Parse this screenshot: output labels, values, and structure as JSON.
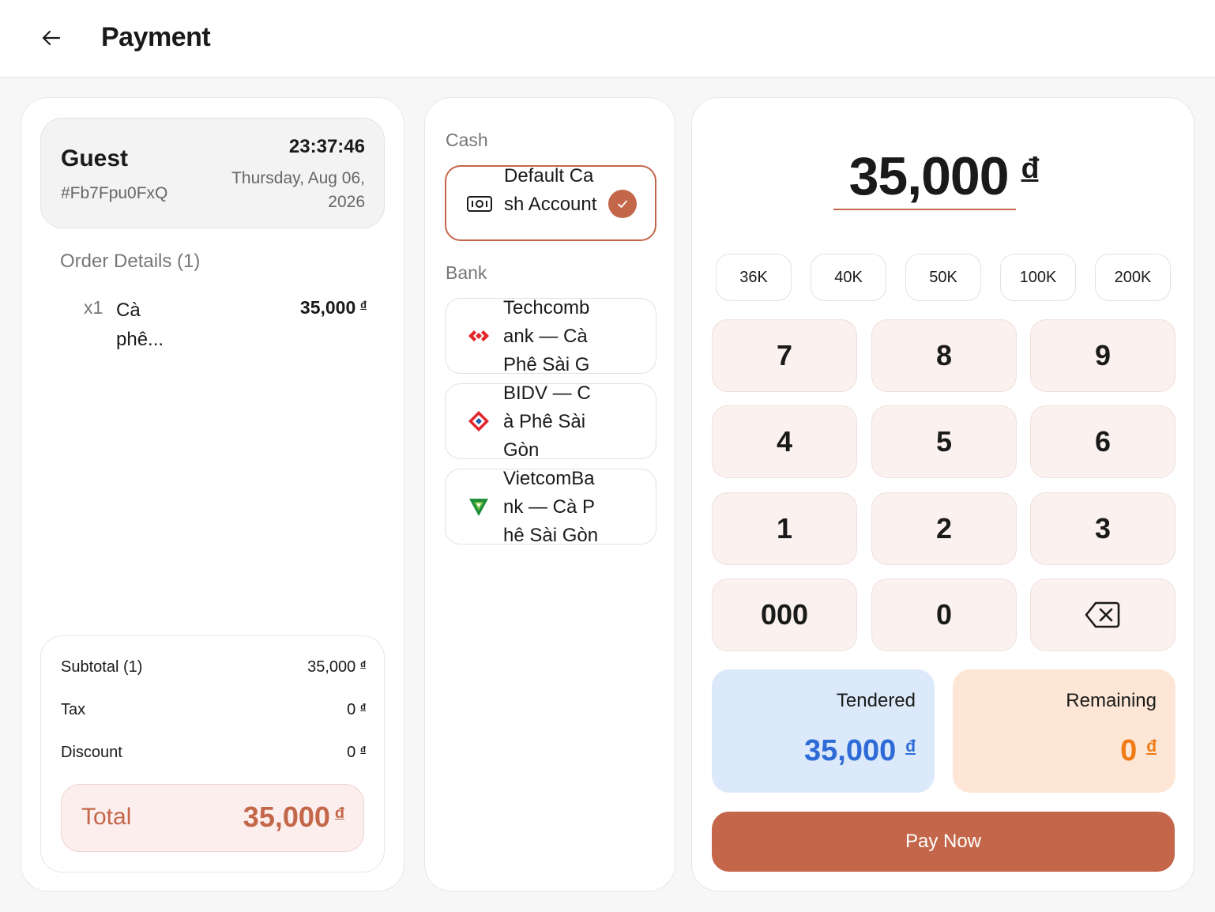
{
  "header": {
    "title": "Payment",
    "back_icon": "arrow-left-icon"
  },
  "guest": {
    "name": "Guest",
    "order_id": "#Fb7Fpu0FxQ",
    "time": "23:37:46",
    "date": "Thursday, Aug 06, 2026"
  },
  "order": {
    "title": "Order Details (1)",
    "items": [
      {
        "qty": "x1",
        "name": "Cà phê...",
        "price": "35,000"
      }
    ]
  },
  "summary": {
    "subtotal_label": "Subtotal (1)",
    "subtotal_value": "35,000",
    "tax_label": "Tax",
    "tax_value": "0",
    "discount_label": "Discount",
    "discount_value": "0",
    "total_label": "Total",
    "total_value": "35,000"
  },
  "currency": "đ",
  "methods": {
    "cash_label": "Cash",
    "bank_label": "Bank",
    "cash": [
      {
        "name": "Default Cash Account",
        "icon": "cash-icon",
        "selected": true
      }
    ],
    "bank": [
      {
        "name": "Techcombank — Cà Phê Sài Gòn",
        "icon": "techcombank-logo-icon"
      },
      {
        "name": "BIDV — Cà Phê Sài Gòn",
        "icon": "bidv-logo-icon"
      },
      {
        "name": "VietcomBank — Cà Phê Sài Gòn",
        "icon": "vietcombank-logo-icon"
      }
    ]
  },
  "keypad": {
    "amount": "35,000",
    "quick_amounts": [
      "36K",
      "40K",
      "50K",
      "100K",
      "200K"
    ],
    "keys": [
      "7",
      "8",
      "9",
      "4",
      "5",
      "6",
      "1",
      "2",
      "3",
      "000",
      "0"
    ],
    "backspace_icon": "backspace-icon"
  },
  "tendered": {
    "label": "Tendered",
    "value": "35,000"
  },
  "remaining": {
    "label": "Remaining",
    "value": "0"
  },
  "pay_button": "Pay Now",
  "colors": {
    "accent": "#c4664a",
    "tendered_bg": "#dce9fb",
    "tendered_text": "#2e6bd6",
    "remaining_bg": "#fde6d6",
    "remaining_text": "#f07a14"
  }
}
